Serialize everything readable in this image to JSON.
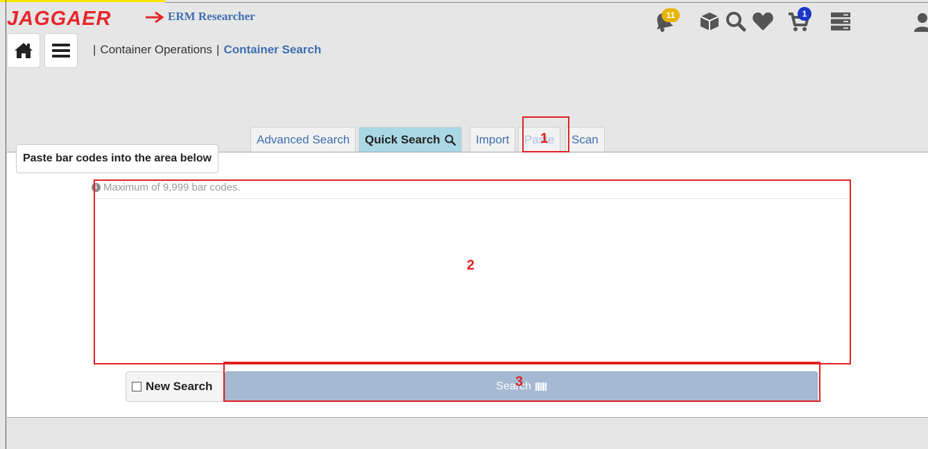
{
  "header": {
    "logo_text": "JAGGAER",
    "app_title": "ERM Researcher",
    "notifications_count": "11",
    "cart_count": "1"
  },
  "breadcrumb": {
    "separator": "|",
    "items": [
      "Container Operations",
      "Container Search"
    ]
  },
  "tabs": [
    {
      "label": "Advanced Search",
      "state": "normal"
    },
    {
      "label": "Quick Search",
      "state": "active"
    },
    {
      "label": "Import",
      "state": "normal"
    },
    {
      "label": "Paste",
      "state": "disabled"
    },
    {
      "label": "Scan",
      "state": "normal"
    }
  ],
  "tooltip": "Paste bar codes into the area below",
  "hint": "Maximum of 9,999 bar codes.",
  "barcode_area": {
    "value": "",
    "placeholder": ""
  },
  "new_search_label": "New Search",
  "search_button_label": "Search",
  "annotations": [
    "1",
    "2",
    "3"
  ],
  "colors": {
    "accent": "#3e6fb0",
    "active_tab": "#aad8e4",
    "search_button": "#a6b9d3",
    "annotation": "#e02020",
    "notification_badge": "#e8b400",
    "cart_badge": "#1a37c8"
  },
  "icons": [
    "home-icon",
    "menu-icon",
    "bell-icon",
    "cube-icon",
    "search-icon",
    "heart-icon",
    "cart-icon",
    "server-icon",
    "user-icon",
    "info-icon",
    "barcode-icon"
  ]
}
